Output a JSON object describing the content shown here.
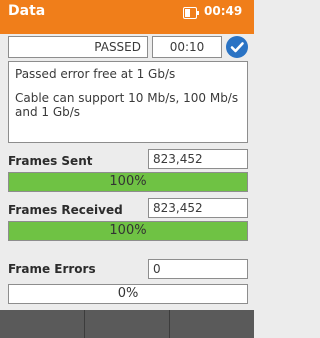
{
  "status_bar": {
    "title": "Data",
    "time": "00:49",
    "battery_icon": "battery-icon"
  },
  "result": {
    "status": "PASSED",
    "timer": "00:10",
    "check_icon": "check-circle-icon",
    "check_color": "#2a73c4"
  },
  "info": {
    "line1": "Passed error free at 1 Gb/s",
    "line2": "Cable can support 10 Mb/s, 100 Mb/s and 1 Gb/s"
  },
  "frames_sent": {
    "label": "Frames Sent",
    "value": "823,452",
    "percent_label": "100%",
    "percent": 100
  },
  "frames_received": {
    "label": "Frames Received",
    "value": "823,452",
    "percent_label": "100%",
    "percent": 100
  },
  "frame_errors": {
    "label": "Frame Errors",
    "value": "0",
    "percent_label": "0%",
    "percent": 0
  },
  "colors": {
    "accent": "#f07e1a",
    "progress": "#6fc244",
    "softkey": "#565656"
  }
}
